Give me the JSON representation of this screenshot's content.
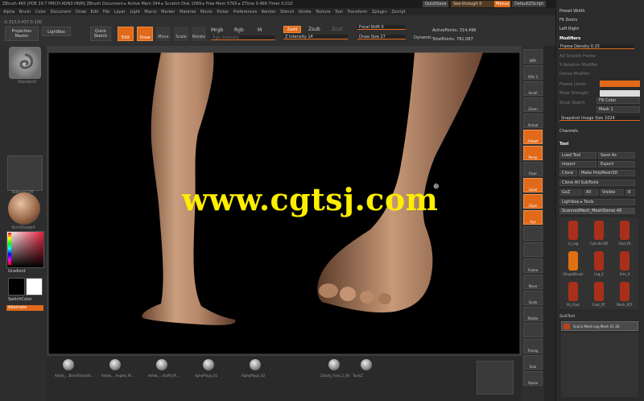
{
  "titlebar": {
    "text": "ZBrush 4R5  [PDE 29.7 PMCH ADN3 HNM]   ZBrush Document   ▸ Active Mem 344 ▸ Scratch Disk 1069 ▸ Free Mem 5765 ▸ ZTime 0.466 Timer 0.010",
    "quicksave": "QuickSave",
    "see_through": "See-through  0",
    "menus": "Menus",
    "default_script": "DefaultZScript"
  },
  "menubar": {
    "items": [
      "Alpha",
      "Brush",
      "Color",
      "Document",
      "Draw",
      "Edit",
      "File",
      "Layer",
      "Light",
      "Macro",
      "Marker",
      "Material",
      "Movie",
      "Picker",
      "Preferences",
      "Render",
      "Stencil",
      "Stroke",
      "Texture",
      "Tool",
      "Transform",
      "Zplugin",
      "Zscript"
    ]
  },
  "shelf": {
    "projection_master": "Projection Master",
    "lightbox": "LightBox",
    "quick_sketch": "Quick Sketch",
    "edit": "Edit",
    "draw": "Draw",
    "move": "Move",
    "scale": "Scale",
    "rotate": "Rotate",
    "mrgb": "Mrgb",
    "rgb": "Rgb",
    "m": "M",
    "rgb_intensity": "Rgb Intensity",
    "zadd": "Zadd",
    "zsub": "Zsub",
    "zcut": "Zcut",
    "z_intensity": "Z Intensity 14",
    "focal_shift": "Focal Shift 0",
    "draw_size": "Draw Size 27",
    "dynamic": "Dynamic",
    "active_points": "ActivePoints: 314,496",
    "total_points": "TotalPoints: 791,087",
    "coords": "-0.313,0.437,0.100"
  },
  "leftpanel": {
    "brush_label": "Standard",
    "texture_label": "Texture Off",
    "material_label": "SkinShade4",
    "gradient": "Gradient",
    "switch_color": "SwitchColor",
    "alternate": "Alternate"
  },
  "viewport": {
    "watermark": "www.cgtsj.com",
    "cursor": "⊕"
  },
  "righttoolbar": {
    "buttons": [
      "BPR",
      "SPix 3",
      "Scroll",
      "Zoom",
      "Actual",
      "AAHalf",
      "Persp",
      "Floor",
      "Local",
      "LSym",
      "Xyz",
      "",
      "",
      "Frame",
      "Move",
      "Scale",
      "Rotate",
      "",
      "Transp",
      "Solo",
      "Xpose"
    ],
    "orange_index": [
      5,
      6,
      8,
      9,
      10
    ]
  },
  "tray": {
    "header_items": [
      "Preset Width",
      "Fit Doors",
      "Left Right"
    ],
    "modifiers": "Modifiers",
    "frame_density": "Frame Density 0.15",
    "rows": [
      "Ad Smooth Frame",
      "X Rotation Modifier",
      "Dense Modifier",
      "Freeze Limits",
      "Mask Strength",
      "Show Sketch"
    ],
    "fill_color": "Fill Color",
    "mask1": "Mask 1",
    "snapshot": "Snapshot Image Size 1024",
    "channels": "Channels",
    "tool": "Tool",
    "load_tool": "Load Tool",
    "save_as": "Save As",
    "import": "Import",
    "export": "Export",
    "clone": "Clone",
    "make_polymesh": "Make PolyMesh3D",
    "clone_all": "Clone All SubTools",
    "goz": "GoZ",
    "all": "All",
    "visible": "Visible",
    "r": "R",
    "lightbox_tools": "Lightbox ▸ Tools",
    "scanned_label": "ScannedMesh_MeshDense 48",
    "thumbs": [
      "Lt_Leg",
      "Cylinder3D",
      "Foot_Rt",
      "SimpleBrush",
      "Leg_0",
      "Arm_0",
      "RL_Foot",
      "Foot_RT",
      "Mesh_RTF"
    ],
    "subtool": "SubTool",
    "subtool_name": "Scan1 Mesh Leg  Mesh 01 3D"
  },
  "bottom": {
    "items": [
      "Anteb_...BreshSmooth...",
      "Anteb_...Angles_M...",
      "Anteb_...stuffit_M...",
      "AphaPlaya_01",
      "AlphaPlaya_02",
      "Zaliety_Foot_2_49",
      "ToolsZ"
    ]
  }
}
